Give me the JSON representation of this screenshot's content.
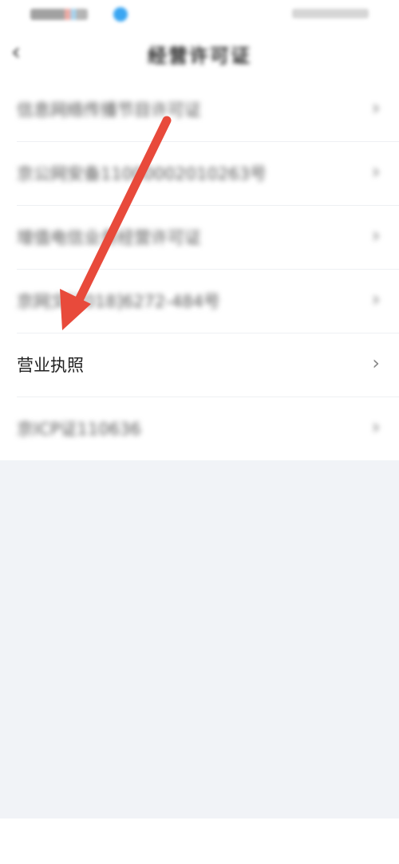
{
  "status_bar": {
    "left": "",
    "right": ""
  },
  "header": {
    "back_icon": "chevron-left-icon",
    "title": "经营许可证"
  },
  "list": {
    "items": [
      {
        "label": "信息网络传播节目许可证",
        "blurred": true
      },
      {
        "label": "京公网安备11000002010263号",
        "blurred": true
      },
      {
        "label": "增值电信业务经营许可证",
        "blurred": true
      },
      {
        "label": "京网文[2018]6272-484号",
        "blurred": true
      },
      {
        "label": "营业执照",
        "blurred": false
      },
      {
        "label": "京ICP证110636",
        "blurred": true
      }
    ],
    "chevron_icon": "chevron-right-icon"
  },
  "annotation": {
    "arrow_color": "#e84a3b",
    "target_item": "营业执照"
  }
}
